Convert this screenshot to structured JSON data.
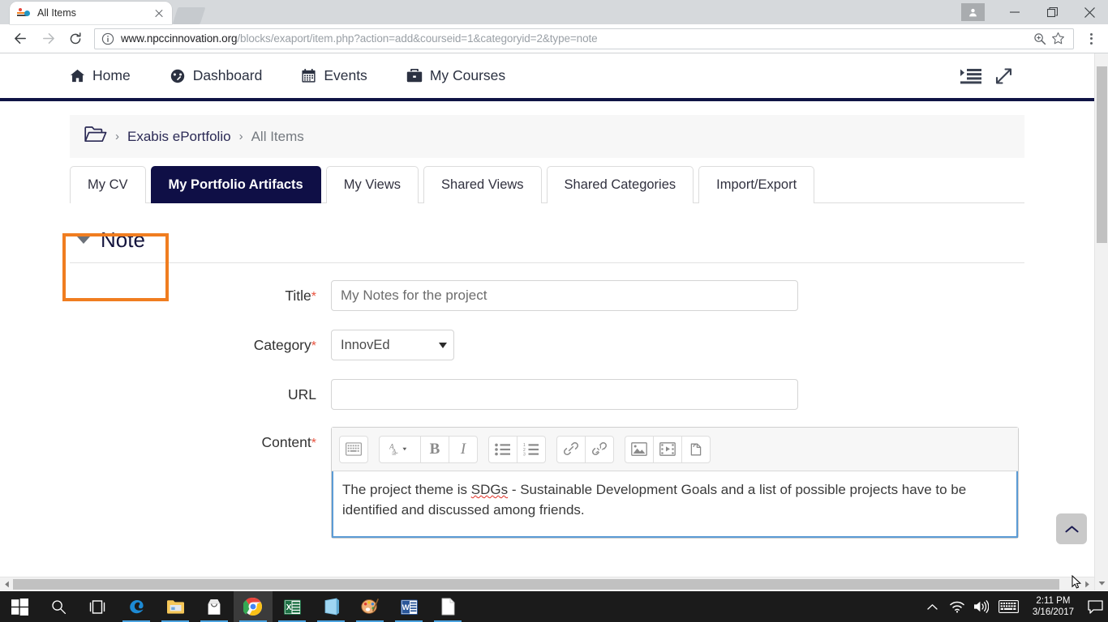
{
  "browser": {
    "tab": {
      "title": "All Items",
      "favicon": "moodle-favicon",
      "close_icon": "close-icon"
    },
    "new_tab_icon": "new-tab-icon",
    "back_icon": "back-arrow-icon",
    "forward_icon": "forward-arrow-icon",
    "reload_icon": "reload-icon",
    "info_icon": "page-info-icon",
    "url_domain": "www.npccinnovation.org",
    "url_path": "/blocks/exaport/item.php?action=add&courseid=1&categoryid=2&type=note",
    "zoom_icon": "zoom-in-icon",
    "bookmark_icon": "star-icon",
    "menu_icon": "three-dot-menu-icon",
    "profile_icon": "user-avatar-icon",
    "minimize_icon": "minimize-icon",
    "maximize_icon": "maximize-icon",
    "close_window_icon": "close-window-icon"
  },
  "sitenav": {
    "items": [
      {
        "label": "Home",
        "icon": "home-icon"
      },
      {
        "label": "Dashboard",
        "icon": "dashboard-icon"
      },
      {
        "label": "Events",
        "icon": "calendar-icon"
      },
      {
        "label": "My Courses",
        "icon": "briefcase-icon"
      }
    ],
    "right_icons": [
      {
        "name": "toggle-blocks-icon"
      },
      {
        "name": "fullscreen-expand-icon"
      }
    ]
  },
  "breadcrumb": {
    "folder_icon": "folder-open-icon",
    "separator": "›",
    "link": "Exabis ePortfolio",
    "current": "All Items"
  },
  "tabs": [
    {
      "label": "My CV",
      "active": false
    },
    {
      "label": "My Portfolio Artifacts",
      "active": true
    },
    {
      "label": "My Views",
      "active": false
    },
    {
      "label": "Shared Views",
      "active": false
    },
    {
      "label": "Shared Categories",
      "active": false
    },
    {
      "label": "Import/Export",
      "active": false
    }
  ],
  "section": {
    "title": "Note",
    "collapse_icon": "caret-down-icon",
    "highlight_color": "#f07d20"
  },
  "form": {
    "title": {
      "label": "Title",
      "required": true,
      "value": "My Notes for the project",
      "placeholder": ""
    },
    "category": {
      "label": "Category",
      "required": true,
      "value": "InnovEd",
      "caret_icon": "select-caret-icon"
    },
    "url": {
      "label": "URL",
      "required": false,
      "value": "",
      "placeholder": ""
    },
    "content": {
      "label": "Content",
      "required": true,
      "text_before": "The project theme is ",
      "text_spell": "SDGs",
      "text_after": " - Sustainable Development Goals and a list of possible projects have to be identified and discussed among friends.",
      "toolbar": [
        {
          "name": "expand-toolbar-icon",
          "group": 0
        },
        {
          "name": "font-style-icon",
          "group": 1
        },
        {
          "name": "bold-icon",
          "label": "B",
          "group": 1
        },
        {
          "name": "italic-icon",
          "label": "I",
          "group": 1
        },
        {
          "name": "bullet-list-icon",
          "group": 2
        },
        {
          "name": "numbered-list-icon",
          "group": 2
        },
        {
          "name": "link-icon",
          "group": 3
        },
        {
          "name": "unlink-icon",
          "group": 3
        },
        {
          "name": "insert-image-icon",
          "group": 4
        },
        {
          "name": "insert-media-icon",
          "group": 4
        },
        {
          "name": "manage-files-icon",
          "group": 4
        }
      ]
    }
  },
  "scroll_top_button": {
    "icon": "chevron-up-icon"
  },
  "scrollbars": {
    "vertical_down_icon": "scroll-down-arrow",
    "horizontal_left_icon": "scroll-left-arrow",
    "horizontal_right_icon": "scroll-right-arrow"
  },
  "taskbar": {
    "items": [
      {
        "name": "start-button-icon"
      },
      {
        "name": "search-icon"
      },
      {
        "name": "task-view-icon"
      },
      {
        "name": "edge-browser-icon"
      },
      {
        "name": "file-explorer-icon"
      },
      {
        "name": "microsoft-store-icon"
      },
      {
        "name": "chrome-browser-icon"
      },
      {
        "name": "excel-icon"
      },
      {
        "name": "onenote-icon"
      },
      {
        "name": "paint-icon"
      },
      {
        "name": "word-icon"
      },
      {
        "name": "text-document-icon"
      }
    ],
    "tray": [
      {
        "name": "show-hidden-icons-chevron"
      },
      {
        "name": "wifi-icon"
      },
      {
        "name": "volume-icon"
      },
      {
        "name": "keyboard-icon"
      }
    ],
    "time": "2:11 PM",
    "date": "3/16/2017",
    "notification_icon": "action-center-icon"
  }
}
